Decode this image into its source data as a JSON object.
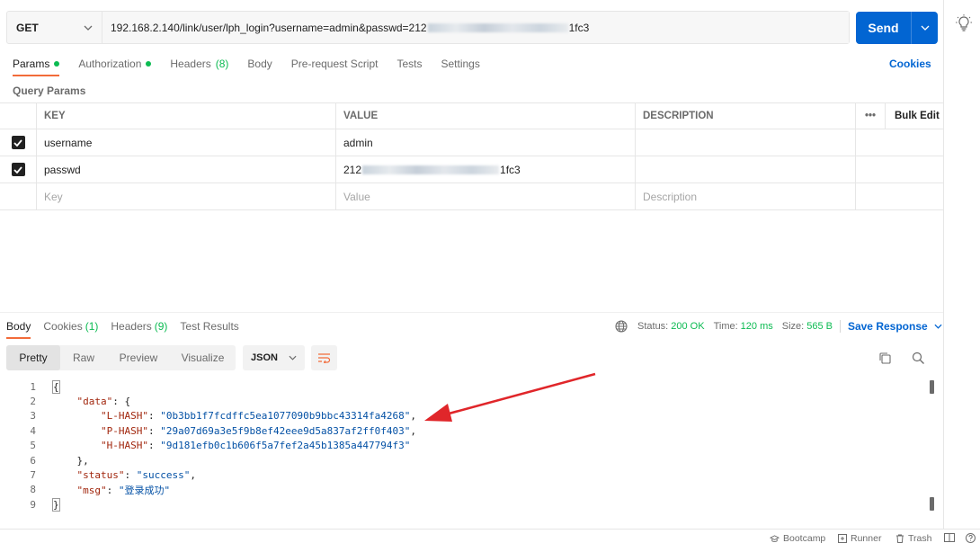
{
  "request": {
    "method": "GET",
    "url_prefix": "192.168.2.140/link/user/lph_login?username=admin&passwd=212",
    "url_suffix": "1fc3",
    "send_label": "Send"
  },
  "req_tabs": [
    {
      "label": "Params",
      "dot": true,
      "count": ""
    },
    {
      "label": "Authorization",
      "dot": true,
      "count": ""
    },
    {
      "label": "Headers",
      "dot": false,
      "count": "(8)"
    },
    {
      "label": "Body",
      "dot": false,
      "count": ""
    },
    {
      "label": "Pre-request Script",
      "dot": false,
      "count": ""
    },
    {
      "label": "Tests",
      "dot": false,
      "count": ""
    },
    {
      "label": "Settings",
      "dot": false,
      "count": ""
    }
  ],
  "cookies_link": "Cookies",
  "query_params_title": "Query Params",
  "params_table": {
    "headers": {
      "key": "KEY",
      "value": "VALUE",
      "description": "DESCRIPTION",
      "bulk_edit": "Bulk Edit",
      "more": "•••"
    },
    "rows": [
      {
        "key": "username",
        "value": "admin",
        "value_suffix": "",
        "checked": true
      },
      {
        "key": "passwd",
        "value": "212",
        "value_suffix": "1fc3",
        "checked": true
      }
    ],
    "placeholders": {
      "key": "Key",
      "value": "Value",
      "description": "Description"
    }
  },
  "resp_tabs": [
    {
      "label": "Body",
      "count": ""
    },
    {
      "label": "Cookies",
      "count": "(1)"
    },
    {
      "label": "Headers",
      "count": "(9)"
    },
    {
      "label": "Test Results",
      "count": ""
    }
  ],
  "status": {
    "status_label": "Status:",
    "status_value": "200 OK",
    "time_label": "Time:",
    "time_value": "120 ms",
    "size_label": "Size:",
    "size_value": "565 B",
    "save_label": "Save Response"
  },
  "view_modes": [
    "Pretty",
    "Raw",
    "Preview",
    "Visualize"
  ],
  "format": "JSON",
  "code_lines": [
    {
      "n": "1",
      "t": "{"
    },
    {
      "n": "2",
      "t": "    \"data\": {"
    },
    {
      "n": "3",
      "t": "        \"L-HASH\": \"0b3bb1f7fcdffc5ea1077090b9bbc43314fa4268\","
    },
    {
      "n": "4",
      "t": "        \"P-HASH\": \"29a07d69a3e5f9b8ef42eee9d5a837af2ff0f403\","
    },
    {
      "n": "5",
      "t": "        \"H-HASH\": \"9d181efb0c1b606f5a7fef2a45b1385a447794f3\""
    },
    {
      "n": "6",
      "t": "    },"
    },
    {
      "n": "7",
      "t": "    \"status\": \"success\","
    },
    {
      "n": "8",
      "t": "    \"msg\": \"登录成功\""
    },
    {
      "n": "9",
      "t": "}"
    }
  ],
  "footer": {
    "bootcamp": "Bootcamp",
    "runner": "Runner",
    "trash": "Trash"
  },
  "colors": {
    "accent": "#0265d2",
    "tab_underline": "#f26b3a",
    "green": "#0cbb52",
    "arrow": "#e0262a"
  }
}
